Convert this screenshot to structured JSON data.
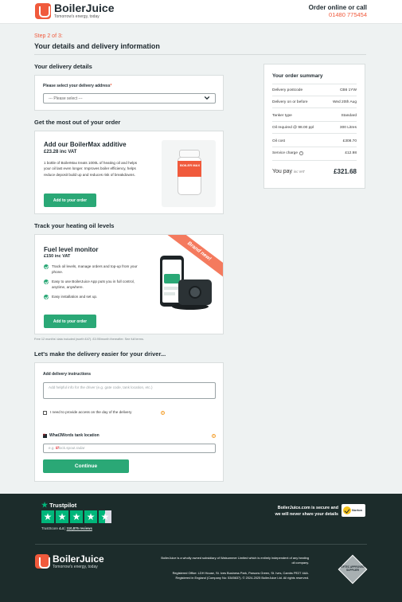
{
  "header": {
    "brand_name": "BoilerJuice",
    "brand_tagline": "Tomorrow's energy, today",
    "order_online_label": "Order online or call",
    "phone": "01480 775454"
  },
  "progress": {
    "step": "Step 2 of 3:",
    "title": "Your details and delivery information"
  },
  "delivery": {
    "section_title": "Your delivery details",
    "address_label": "Please select your delivery address",
    "address_required_mark": "*",
    "address_placeholder": "--- Please select ---"
  },
  "boilermax": {
    "section_title": "Get the most out of your order",
    "title": "Add our BoilerMax additive",
    "price": "£23.28 inc VAT",
    "description": "1 bottle of BoilerMax treats 1000L of heating oil and helps your oil last even longer. Improves boiler efficiency, helps reduce deposit build up and reduces risk of breakdowns.",
    "button": "Add to your order",
    "bottle_label": "BOILER MAX"
  },
  "fuel_monitor": {
    "section_title": "Track your heating oil levels",
    "title": "Fuel level monitor",
    "price": "£150 inc VAT",
    "ribbon": "Brand new!",
    "features": [
      "Track oil levels, manage orders and top-up from your phone.",
      "Easy to use BoilerJuice App puts you in full control, anytime, anywhere.",
      "Easy installation and set up."
    ],
    "button": "Add to your order",
    "fine_print": "Free 12 months' data included (worth £47). £3.95/month thereafter. See full terms."
  },
  "driver": {
    "section_title": "Let's make the delivery easier for your driver...",
    "instructions_label": "Add delivery instructions",
    "instructions_placeholder": "Add helpful info for the driver (e.g. gate code, tank location, etc.)",
    "access_label": "I need to provide access on the day of the delivery",
    "w3w_label": "What3Words tank location",
    "w3w_placeholder_prefix": "e.g. ",
    "w3w_slashes": "///",
    "w3w_placeholder_words": "lock.spout.radar",
    "continue_button": "Continue",
    "info_glyph": "?"
  },
  "summary": {
    "title": "Your order summary",
    "rows": [
      {
        "label": "Delivery postcode",
        "value": "CB6 1YW"
      },
      {
        "label": "Delivery on or before",
        "value": "Wed 20th Aug"
      },
      {
        "label": "Tanker type",
        "value": "Standard"
      },
      {
        "label": "Oil required @ 98.00 ppl",
        "value": "300 Litres"
      },
      {
        "label": "Oil cost",
        "value": "£308.70"
      },
      {
        "label": "Service charge",
        "value": "£12.98"
      }
    ],
    "you_pay": "You pay",
    "inc_vat": "inc VAT",
    "total": "£321.68"
  },
  "footer": {
    "trustpilot": "Trustpilot",
    "trustscore_label": "TrustScore",
    "trustscore_value": "4.4",
    "separator": "|",
    "reviews": "110,875 reviews",
    "rating_stars": 4.5,
    "secure_text_1": "BoilerJuice.com is secure and",
    "secure_text_2": "we will never share your details",
    "norton": "Norton",
    "brand_name": "BoilerJuice",
    "brand_tagline": "Tomorrow's energy, today",
    "subsidiary": "BoilerJuice is a wholly owned subsidiary of Watsummer Limited which is entirely independent of any heating oil company.",
    "registered": "Registered Office: LDH House, St. Ives Business Park, Parsons Green, St. Ives, Cambs PE27 4AA. Registered in England (Company No: 5345637). © 2024-2025 BoilerJuice Ltd. All rights reserved.",
    "oftec": "OFTEC APPROVED SUPPLIER"
  },
  "colors": {
    "brand_orange": "#f05a3c",
    "cta_green": "#2aa876",
    "trustpilot_green": "#00b67a",
    "footer_bg": "#1c2c2b"
  }
}
